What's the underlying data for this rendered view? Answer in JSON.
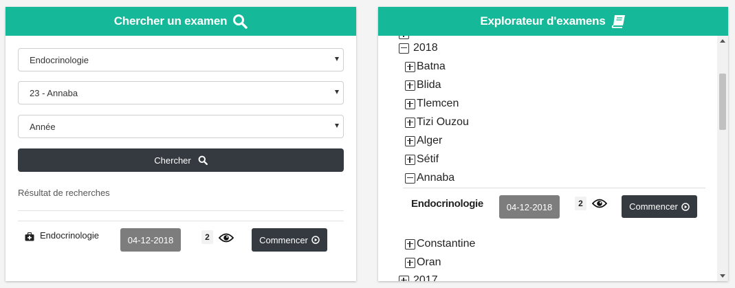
{
  "search_panel": {
    "title": "Chercher un examen",
    "specialty_select": {
      "selected": "Endocrinologie"
    },
    "center_select": {
      "selected": "23 - Annaba"
    },
    "year_select": {
      "selected": "Année"
    },
    "search_button_label": "Chercher",
    "results_title": "Résultat de recherches",
    "results": [
      {
        "name": "Endocrinologie",
        "date": "04-12-2018",
        "count": "2",
        "action_label": "Commencer"
      }
    ]
  },
  "explorer_panel": {
    "title": "Explorateur d'examens",
    "tree": {
      "year_2018": "2018",
      "cities": [
        "Batna",
        "Blida",
        "Tlemcen",
        "Tizi Ouzou",
        "Alger",
        "Sétif",
        "Annaba"
      ],
      "expanded_city_exam": {
        "name": "Endocrinologie",
        "date": "04-12-2018",
        "count": "2",
        "action_label": "Commencer"
      },
      "more_cities": [
        "Constantine",
        "Oran"
      ],
      "year_2017": "2017"
    }
  },
  "colors": {
    "header": "#16b89a",
    "dark_button": "#343a40",
    "date_badge": "#7d7d7d"
  },
  "icons": [
    "search-icon",
    "book-icon",
    "medical-kit-icon",
    "eye-icon",
    "play-circle-icon",
    "tree-expand-icon",
    "tree-collapse-icon"
  ]
}
